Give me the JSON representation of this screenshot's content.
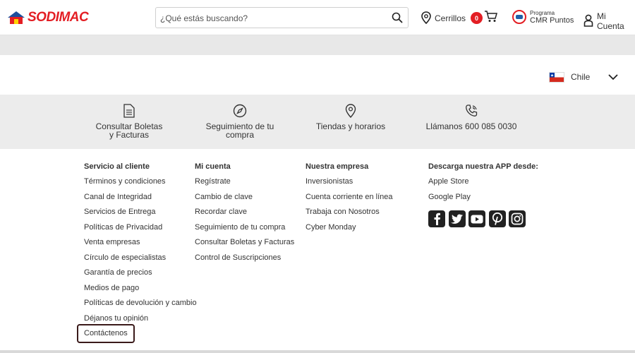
{
  "header": {
    "brand": "SODIMAC",
    "search": {
      "placeholder": "¿Qué estás buscando?",
      "value": ""
    },
    "location": "Cerrillos",
    "cart_count": "0",
    "cmr": {
      "small": "Programa",
      "big": "CMR Puntos"
    },
    "account": "Mi Cuenta"
  },
  "country": {
    "name": "Chile"
  },
  "services": [
    {
      "label_line1": "Consultar Boletas",
      "label_line2": "y Facturas",
      "icon": "document-icon"
    },
    {
      "label_line1": "Seguimiento de tu",
      "label_line2": "compra",
      "icon": "compass-icon"
    },
    {
      "label_line1": "Tiendas y horarios",
      "label_line2": "",
      "icon": "location-pin-icon"
    },
    {
      "label_line1": "Llámanos 600 085 0030",
      "label_line2": "",
      "icon": "phone-icon"
    }
  ],
  "footer": {
    "col1": {
      "title": "Servicio al cliente",
      "items": [
        "Términos y condiciones",
        "Canal de Integridad",
        "Servicios de Entrega",
        "Políticas de Privacidad",
        "Venta empresas",
        "Círculo de especialistas",
        "Garantía de precios",
        "Medios de pago",
        "Políticas de devolución y cambio",
        "Déjanos tu opinión",
        "Contáctenos"
      ]
    },
    "col2": {
      "title": "Mi cuenta",
      "items": [
        "Regístrate",
        "Cambio de clave",
        "Recordar clave",
        "Seguimiento de tu compra",
        "Consultar Boletas y Facturas",
        "Control de Suscripciones"
      ]
    },
    "col3": {
      "title": "Nuestra empresa",
      "items": [
        "Inversionistas",
        "Cuenta corriente en línea",
        "Trabaja con Nosotros",
        "Cyber Monday"
      ]
    },
    "col4": {
      "title": "Descarga nuestra APP desde:",
      "items": [
        "Apple Store",
        "Google Play"
      ],
      "social": [
        "facebook-icon",
        "twitter-icon",
        "youtube-icon",
        "pinterest-icon",
        "instagram-icon"
      ]
    }
  },
  "colors": {
    "brand_red": "#e31e24",
    "band_grey": "#e8e8e8",
    "strip_grey": "#ececec"
  }
}
